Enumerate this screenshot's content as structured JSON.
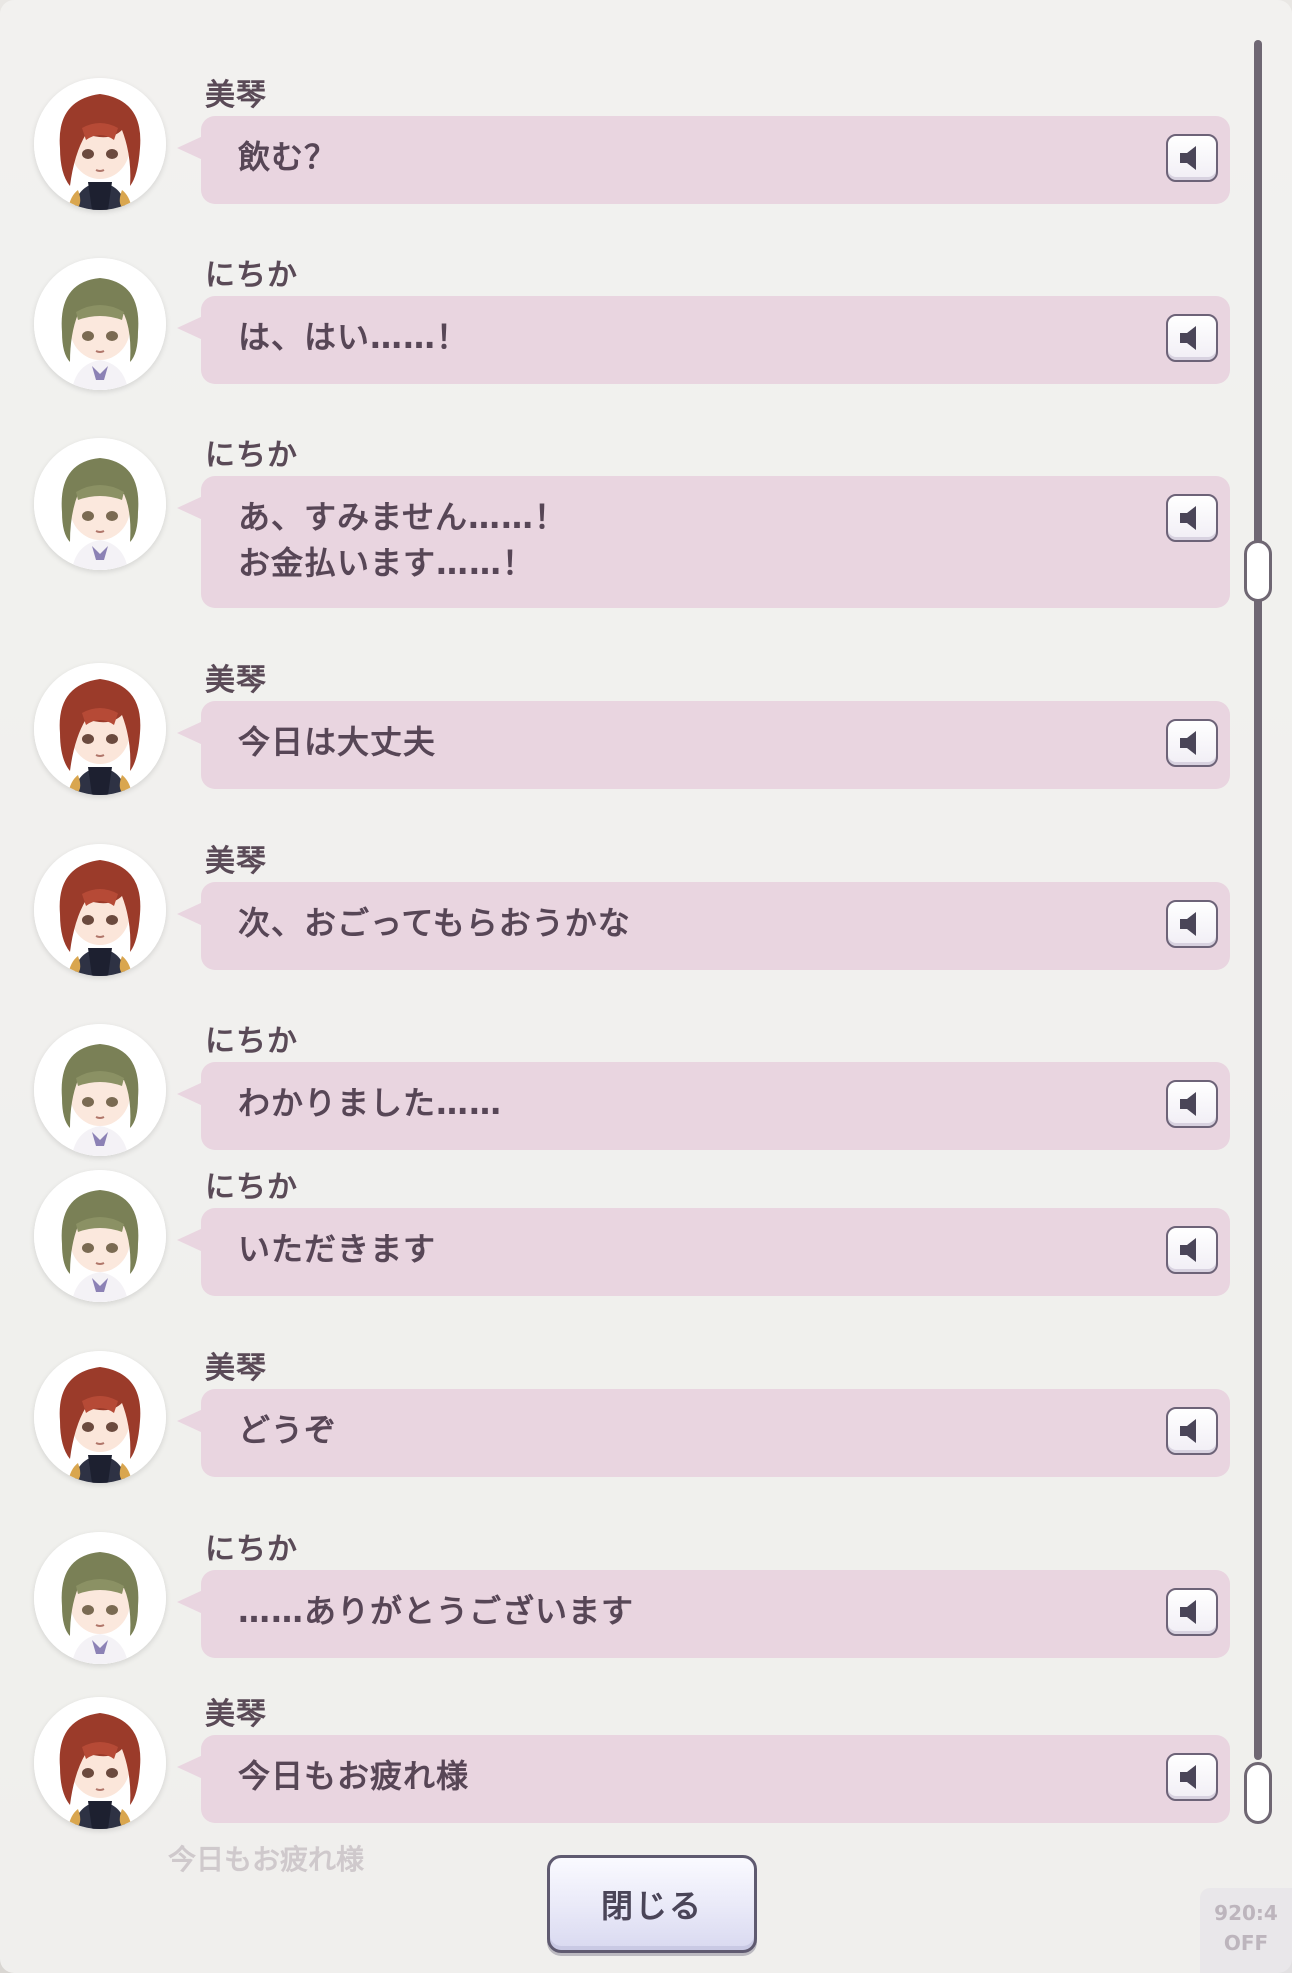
{
  "entries": [
    {
      "speaker": "美琴",
      "character": "mikoto",
      "text": "飲む？"
    },
    {
      "speaker": "にちか",
      "character": "nichika",
      "text": "は、はい……！"
    },
    {
      "speaker": "にちか",
      "character": "nichika",
      "text": "あ、すみません……！\nお金払います……！"
    },
    {
      "speaker": "美琴",
      "character": "mikoto",
      "text": "今日は大丈夫"
    },
    {
      "speaker": "美琴",
      "character": "mikoto",
      "text": "次、おごってもらおうかな"
    },
    {
      "speaker": "にちか",
      "character": "nichika",
      "text": "わかりました……"
    },
    {
      "speaker": "にちか",
      "character": "nichika",
      "text": "いただきます"
    },
    {
      "speaker": "美琴",
      "character": "mikoto",
      "text": "どうぞ"
    },
    {
      "speaker": "にちか",
      "character": "nichika",
      "text": "……ありがとうございます"
    },
    {
      "speaker": "美琴",
      "character": "mikoto",
      "text": "今日もお疲れ様"
    }
  ],
  "background_text": {
    "dialogue": "今日もお疲れ様",
    "badge": "920:4\nOFF"
  },
  "close_button": {
    "label": "閉じる"
  },
  "icons": {
    "voice": "speaker-icon"
  },
  "colors": {
    "bubble": "#e9d5e0",
    "text": "#574656",
    "scrollbar": "#6f6773",
    "mikoto_hair": "#9b3b2a",
    "nichika_hair": "#7a8056"
  }
}
